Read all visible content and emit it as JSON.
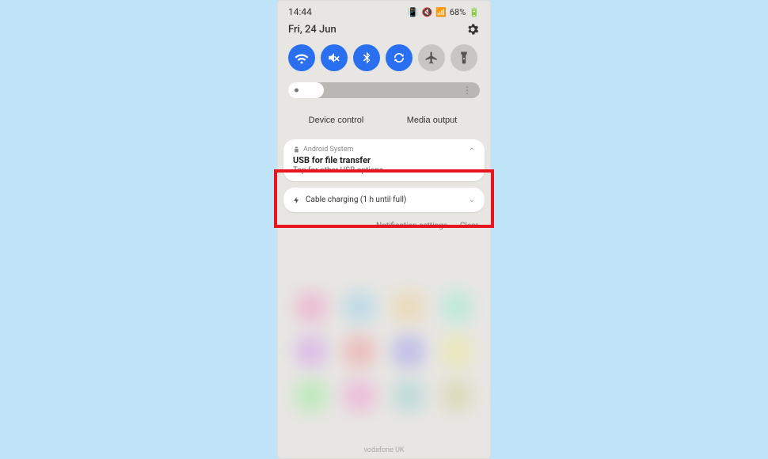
{
  "status": {
    "time": "14:44",
    "battery_text": "68%"
  },
  "date": "Fri, 24 Jun",
  "toggles": [
    {
      "name": "wifi",
      "on": true
    },
    {
      "name": "mute",
      "on": true
    },
    {
      "name": "bluetooth",
      "on": true
    },
    {
      "name": "autorotate",
      "on": true
    },
    {
      "name": "airplane",
      "on": false
    },
    {
      "name": "flashlight",
      "on": false
    }
  ],
  "dm": {
    "device_control": "Device control",
    "media_output": "Media output"
  },
  "notifications": {
    "usb": {
      "source": "Android System",
      "title": "USB for file transfer",
      "subtitle": "Tap for other USB options."
    },
    "charging": {
      "text": "Cable charging (1 h until full)"
    }
  },
  "footer": {
    "settings": "Notification settings",
    "clear": "Clear"
  },
  "carrier": "vodafone UK"
}
